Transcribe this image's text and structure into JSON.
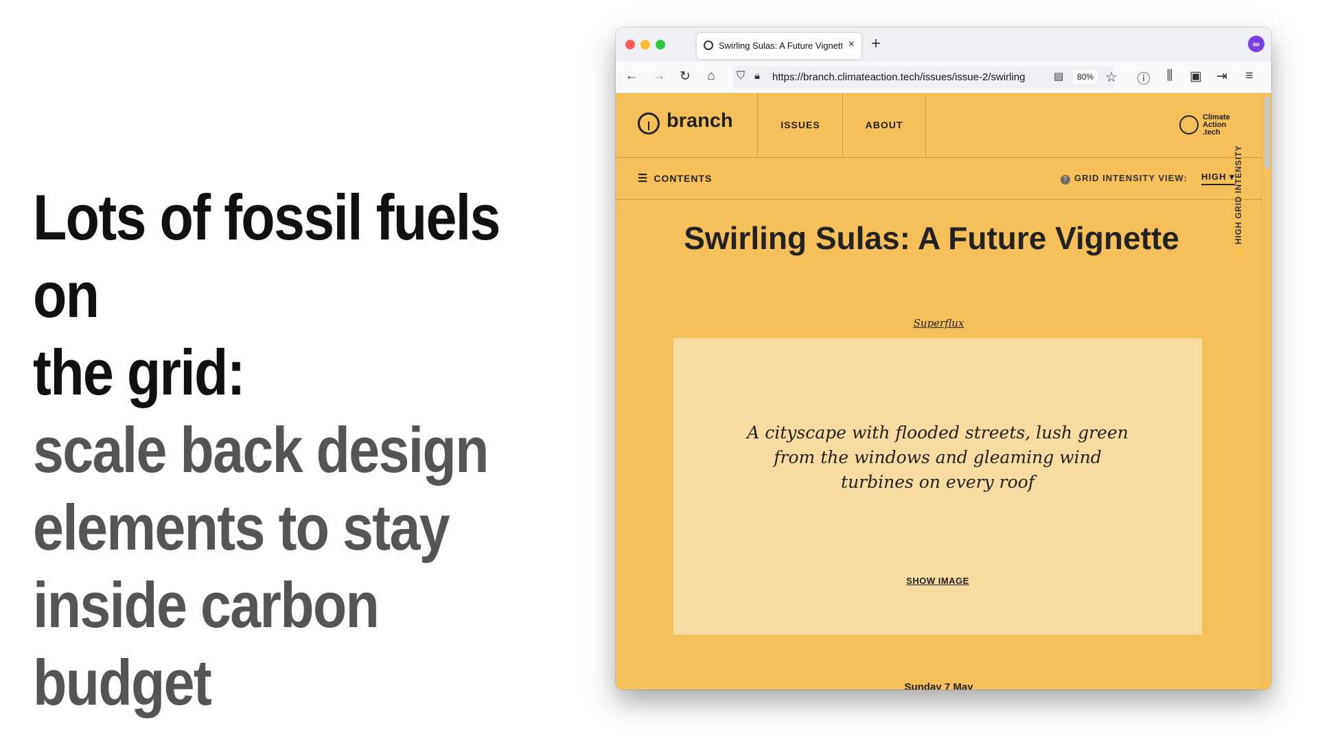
{
  "slide": {
    "heading_line1": "Lots of fossil fuels on",
    "heading_line2": "the grid:",
    "sub_line1": "scale back design",
    "sub_line2": "elements to stay",
    "sub_line3": "inside carbon budget"
  },
  "browser": {
    "tab_title": "Swirling Sulas: A Future Vignette",
    "tab_close": "×",
    "new_tab": "+",
    "url": "https://branch.climateaction.tech/issues/issue-2/swirling",
    "zoom": "80%"
  },
  "site": {
    "logo_text": "branch",
    "menu": [
      "ISSUES",
      "ABOUT"
    ],
    "partner_logo": "Climate Action .tech",
    "contents_label": "CONTENTS",
    "grid_label": "GRID INTENSITY VIEW:",
    "grid_value": "HIGH ▾",
    "side_label": "⚡ HIGH GRID INTENSITY"
  },
  "article": {
    "title": "Swirling Sulas: A Future Vignette",
    "author": "Superflux",
    "image_alt": "A cityscape with flooded streets, lush green from the windows and gleaming wind turbines on every roof",
    "show_image": "SHOW IMAGE",
    "next_heading": "Sunday 7 May"
  }
}
